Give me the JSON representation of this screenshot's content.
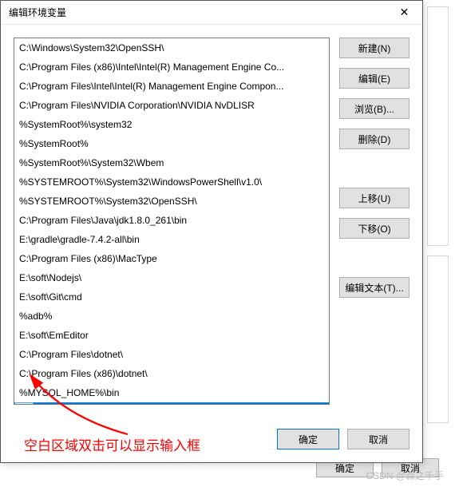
{
  "dialog": {
    "title": "编辑环境变量",
    "close_icon": "✕"
  },
  "path_entries": [
    "C:\\Windows\\System32\\OpenSSH\\",
    "C:\\Program Files (x86)\\Intel\\Intel(R) Management Engine Co...",
    "C:\\Program Files\\Intel\\Intel(R) Management Engine Compon...",
    "C:\\Program Files\\NVIDIA Corporation\\NVIDIA NvDLISR",
    "%SystemRoot%\\system32",
    "%SystemRoot%",
    "%SystemRoot%\\System32\\Wbem",
    "%SYSTEMROOT%\\System32\\WindowsPowerShell\\v1.0\\",
    "%SYSTEMROOT%\\System32\\OpenSSH\\",
    "C:\\Program Files\\Java\\jdk1.8.0_261\\bin",
    "E:\\gradle\\gradle-7.4.2-all\\bin",
    "C:\\Program Files (x86)\\MacType",
    "E:\\soft\\Nodejs\\",
    "E:\\soft\\Git\\cmd",
    "%adb%",
    "E:\\soft\\EmEditor",
    "C:\\Program Files\\dotnet\\",
    "C:\\Program Files (x86)\\dotnet\\",
    "%MYSQL_HOME%\\bin"
  ],
  "edit_row": {
    "value": ""
  },
  "buttons": {
    "new": "新建(N)",
    "edit": "编辑(E)",
    "browse": "浏览(B)...",
    "delete": "删除(D)",
    "move_up": "上移(U)",
    "move_down": "下移(O)",
    "edit_text": "编辑文本(T)...",
    "ok": "确定",
    "cancel": "取消"
  },
  "outer_buttons": {
    "ok": "确定",
    "cancel": "取消"
  },
  "annotation": {
    "text": "空白区域双击可以显示输入框"
  },
  "watermark": "CSDN @森之千手"
}
